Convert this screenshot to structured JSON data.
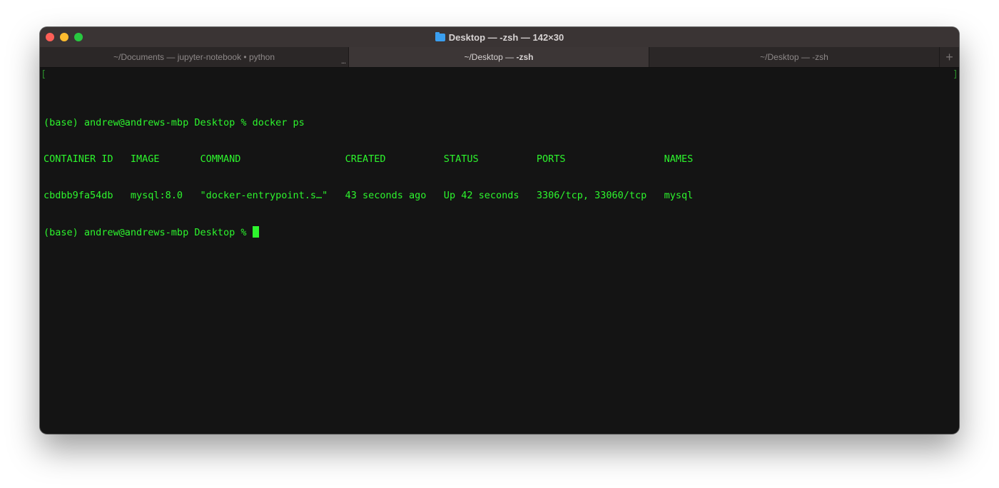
{
  "window": {
    "title": "Desktop — -zsh — 142×30",
    "folder_icon": "folder-icon"
  },
  "tabs": [
    {
      "label": "~/Documents — jupyter-notebook • python",
      "more": "...",
      "active": false
    },
    {
      "label_prefix": "~/Desktop — ",
      "label_bold": "-zsh",
      "active": true
    },
    {
      "label": "~/Desktop — -zsh",
      "active": false
    }
  ],
  "new_tab": "+",
  "terminal": {
    "color": "#2df52d",
    "lines": [
      "(base) andrew@andrews-mbp Desktop % docker ps",
      "CONTAINER ID   IMAGE       COMMAND                  CREATED          STATUS          PORTS                 NAMES",
      "cbdbb9fa54db   mysql:8.0   \"docker-entrypoint.s…\"   43 seconds ago   Up 42 seconds   3306/tcp, 33060/tcp   mysql"
    ],
    "prompt": "(base) andrew@andrews-mbp Desktop % ",
    "bracket_left": "[",
    "bracket_right": "]"
  }
}
